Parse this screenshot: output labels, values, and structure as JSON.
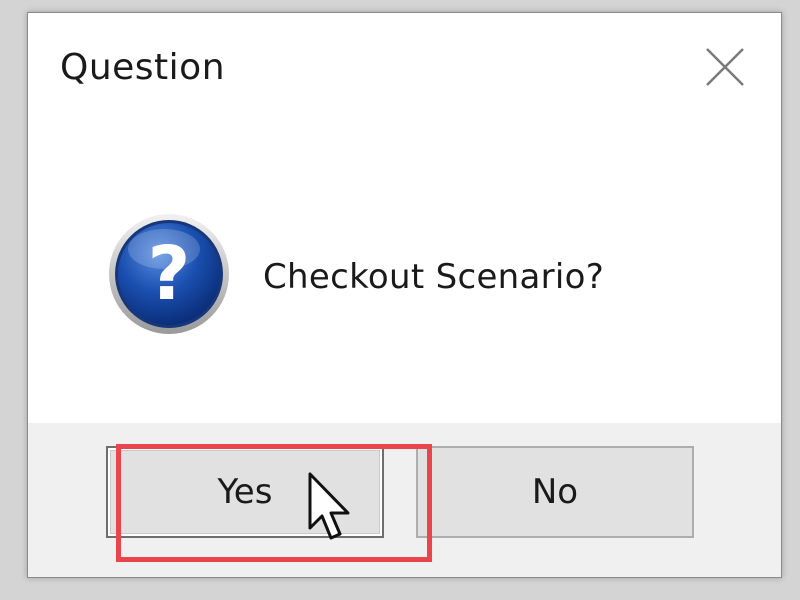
{
  "dialog": {
    "title": "Question",
    "close_icon": "close-icon",
    "message_icon": "question-icon",
    "message": "Checkout Scenario?"
  },
  "buttons": {
    "yes_label": "Yes",
    "no_label": "No"
  },
  "annotation": {
    "highlight_color": "#e8454c",
    "highlight_target": "yes-button"
  },
  "colors": {
    "icon_blue": "#1a4fb0",
    "footer_bg": "#f0f0f0",
    "button_bg": "#e1e1e1"
  }
}
